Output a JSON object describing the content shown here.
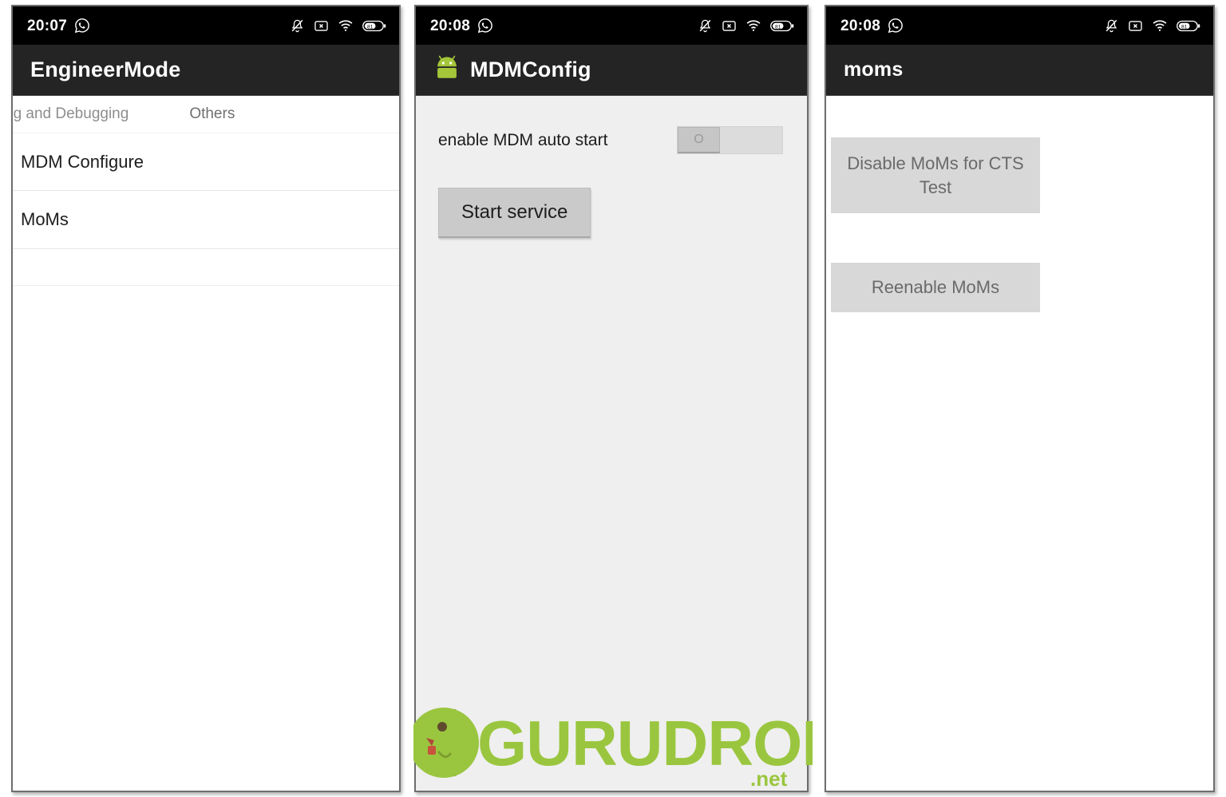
{
  "panels": [
    {
      "id": "engineermode",
      "statusbar": {
        "time": "20:07",
        "left_icons": [
          "whatsapp-icon"
        ],
        "right_icons": [
          "notifications-muted-icon",
          "screenshot-icon",
          "wifi-icon",
          "battery-icon"
        ],
        "battery_level": "81"
      },
      "appbar": {
        "title": "EngineerMode",
        "has_app_icon": false
      },
      "tabs": [
        {
          "label": "og and Debugging"
        },
        {
          "label": "Others"
        }
      ],
      "list": [
        {
          "label": "MDM Configure"
        },
        {
          "label": "MoMs"
        }
      ]
    },
    {
      "id": "mdmconfig",
      "statusbar": {
        "time": "20:08",
        "left_icons": [
          "whatsapp-icon"
        ],
        "right_icons": [
          "notifications-muted-icon",
          "screenshot-icon",
          "wifi-icon",
          "battery-icon"
        ],
        "battery_level": "81"
      },
      "appbar": {
        "title": "MDMConfig",
        "has_app_icon": true,
        "app_icon": "android-robot-icon"
      },
      "setting": {
        "label": "enable MDM auto start",
        "toggle_state": "off",
        "toggle_label": "O"
      },
      "start_button": {
        "label": "Start service"
      }
    },
    {
      "id": "moms",
      "statusbar": {
        "time": "20:08",
        "left_icons": [
          "whatsapp-icon"
        ],
        "right_icons": [
          "notifications-muted-icon",
          "screenshot-icon",
          "wifi-icon",
          "battery-icon"
        ],
        "battery_level": "81"
      },
      "appbar": {
        "title": "moms",
        "has_app_icon": false
      },
      "buttons": [
        {
          "label": "Disable MoMs for CTS Test"
        },
        {
          "label": "Reenable MoMs"
        }
      ]
    }
  ],
  "watermark": {
    "text": "GURUDROID",
    "suffix": ".net",
    "color": "#9ac63f",
    "mascot": "android-head-icon"
  },
  "colors": {
    "statusbar_bg": "#000000",
    "appbar_bg": "#242424",
    "appbar_text": "#ffffff",
    "panel_border": "#6e6e6e",
    "mdm_body_bg": "#efefef",
    "button_bg": "#cacaca",
    "moms_button_bg": "#d8d8d8",
    "moms_button_text": "#6a6a6a",
    "android_green": "#a4c639"
  }
}
